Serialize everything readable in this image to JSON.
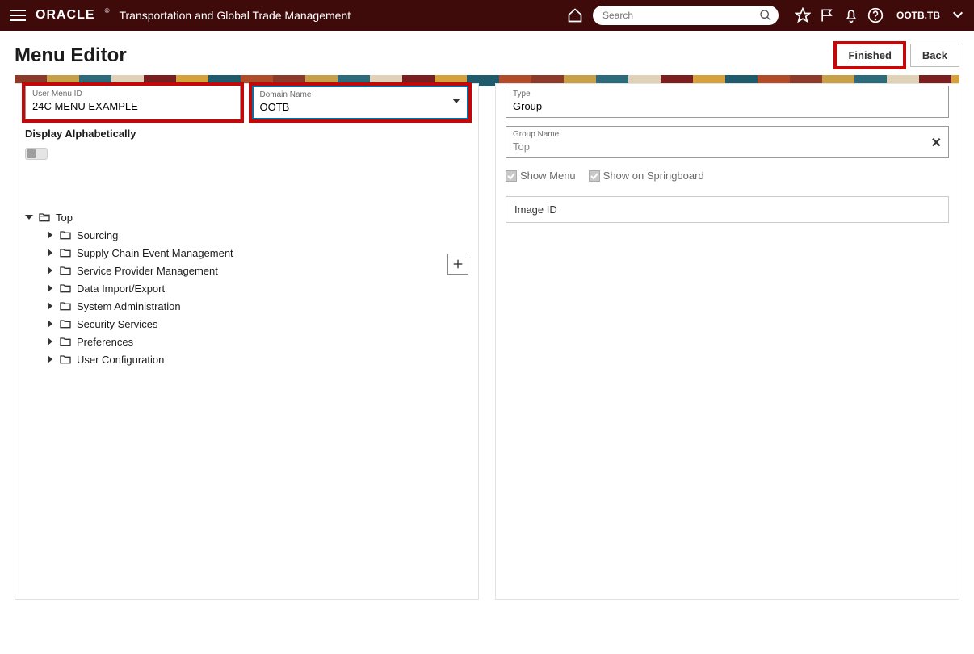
{
  "header": {
    "brand": "ORACLE",
    "app_title": "Transportation and Global Trade Management",
    "search_placeholder": "Search",
    "user": "OOTB.TB"
  },
  "page": {
    "title": "Menu Editor",
    "actions": {
      "finished": "Finished",
      "back": "Back"
    }
  },
  "left": {
    "user_menu_id_label": "User Menu ID",
    "user_menu_id_value": "24C MENU EXAMPLE",
    "domain_name_label": "Domain Name",
    "domain_name_value": "OOTB",
    "display_alpha_label": "Display Alphabetically",
    "tree": {
      "root": "Top",
      "children": [
        "Sourcing",
        "Supply Chain Event Management",
        "Service Provider Management",
        "Data Import/Export",
        "System Administration",
        "Security Services",
        "Preferences",
        "User Configuration"
      ]
    }
  },
  "right": {
    "type_label": "Type",
    "type_value": "Group",
    "group_name_label": "Group Name",
    "group_name_value": "Top",
    "show_menu_label": "Show Menu",
    "show_springboard_label": "Show on Springboard",
    "image_id_label": "Image ID"
  }
}
